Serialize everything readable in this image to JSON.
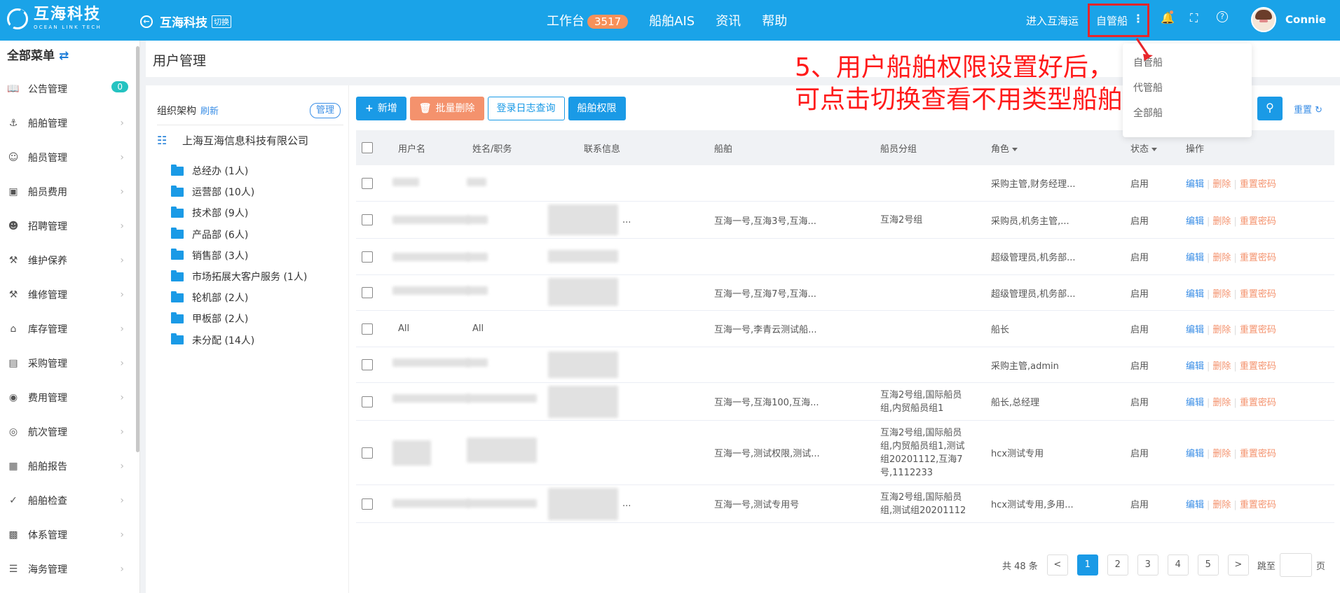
{
  "topbar": {
    "logo_cn": "互海科技",
    "logo_en": "OCEAN LINK TECH",
    "company": "互海科技",
    "switch_tag": "切换",
    "nav": [
      {
        "label": "工作台",
        "badge": "3517"
      },
      {
        "label": "船舶AIS"
      },
      {
        "label": "资讯"
      },
      {
        "label": "帮助"
      }
    ],
    "enter_link": "进入互海运",
    "fleet_selector": "自管船",
    "kebab": "⋮",
    "user_name": "Connie"
  },
  "fleet_dropdown": {
    "options": [
      "自管船",
      "代管船",
      "全部船"
    ]
  },
  "annotation": {
    "line1": "5、用户船舶权限设置好后，",
    "line2": "可点击切换查看不用类型船舶"
  },
  "sidebar": {
    "title": "全部菜单",
    "items": [
      {
        "label": "公告管理",
        "icon": "book-icon",
        "badge": "0"
      },
      {
        "label": "船舶管理",
        "icon": "anchor-icon"
      },
      {
        "label": "船员管理",
        "icon": "person-icon"
      },
      {
        "label": "船员费用",
        "icon": "wallet-icon"
      },
      {
        "label": "招聘管理",
        "icon": "recruit-icon"
      },
      {
        "label": "维护保养",
        "icon": "hammer-icon"
      },
      {
        "label": "维修管理",
        "icon": "wrench-icon"
      },
      {
        "label": "库存管理",
        "icon": "warehouse-icon"
      },
      {
        "label": "采购管理",
        "icon": "cart-icon"
      },
      {
        "label": "费用管理",
        "icon": "coins-icon"
      },
      {
        "label": "航次管理",
        "icon": "globe-icon"
      },
      {
        "label": "船舶报告",
        "icon": "calendar-icon"
      },
      {
        "label": "船舶检查",
        "icon": "check-circle-icon"
      },
      {
        "label": "体系管理",
        "icon": "docs-icon"
      },
      {
        "label": "海务管理",
        "icon": "signpost-icon"
      }
    ]
  },
  "page": {
    "title": "用户管理"
  },
  "org": {
    "header": "组织架构",
    "refresh": "刷新",
    "manage": "管理",
    "company": "上海互海信息科技有限公司",
    "departments": [
      "总经办 (1人)",
      "运营部 (10人)",
      "技术部 (9人)",
      "产品部 (6人)",
      "销售部 (3人)",
      "市场拓展大客户服务 (1人)",
      "轮机部 (2人)",
      "甲板部 (2人)",
      "未分配 (14人)"
    ]
  },
  "toolbar": {
    "add": "新增",
    "batch_delete": "批量删除",
    "login_log": "登录日志查询",
    "ship_permission": "船舶权限",
    "reset": "重置"
  },
  "table": {
    "headers": {
      "username": "用户名",
      "name_title": "姓名/职务",
      "contact": "联系信息",
      "ship": "船舶",
      "crew_group": "船员分组",
      "role": "角色",
      "status": "状态",
      "ops": "操作"
    },
    "op_labels": {
      "edit": "编辑",
      "del": "删除",
      "reset": "重置密码"
    },
    "rows": [
      {
        "username": "",
        "name": "",
        "contact": "",
        "ship": "",
        "crew_group": "",
        "role": "采购主管,财务经理...",
        "status": "启用"
      },
      {
        "username": "",
        "name": "",
        "contact": "...",
        "ship": "互海一号,互海3号,互海...",
        "crew_group": "互海2号组",
        "role": "采购员,机务主管,...",
        "status": "启用"
      },
      {
        "username": "",
        "name": "",
        "contact": "",
        "ship": "",
        "crew_group": "",
        "role": "超级管理员,机务部...",
        "status": "启用"
      },
      {
        "username": "",
        "name": "",
        "contact": "",
        "ship": "互海一号,互海7号,互海...",
        "crew_group": "",
        "role": "超级管理员,机务部...",
        "status": "启用"
      },
      {
        "username": "All",
        "name": "All",
        "contact": "",
        "ship": "互海一号,李青云测试船...",
        "crew_group": "",
        "role": "船长",
        "status": "启用"
      },
      {
        "username": "",
        "name": "",
        "contact": "",
        "ship": "",
        "crew_group": "",
        "role": "采购主管,admin",
        "status": "启用"
      },
      {
        "username": "",
        "name": "",
        "contact": "",
        "ship": "互海一号,互海100,互海...",
        "crew_group": "互海2号组,国际船员组,内贸船员组1",
        "role": "船长,总经理",
        "status": "启用"
      },
      {
        "username": "",
        "name": "",
        "contact": "",
        "ship": "互海一号,测试权限,测试...",
        "crew_group": "互海2号组,国际船员组,内贸船员组1,测试组20201112,互海7号,1112233",
        "role": "hcx测试专用",
        "status": "启用"
      },
      {
        "username": "",
        "name": "",
        "contact": "...",
        "ship": "互海一号,测试专用号",
        "crew_group": "互海2号组,国际船员组,测试组20201112",
        "role": "hcx测试专用,多用...",
        "status": "启用"
      }
    ]
  },
  "pagination": {
    "total": "共 48 条",
    "prev": "<",
    "pages": [
      "1",
      "2",
      "3",
      "4",
      "5"
    ],
    "next": ">",
    "goto": "跳至",
    "page_unit": "页"
  },
  "colors": {
    "brand": "#1aa3e8",
    "annotation": "#ff1a1a",
    "danger": "#f4926d",
    "badge": "#25c3c1"
  }
}
